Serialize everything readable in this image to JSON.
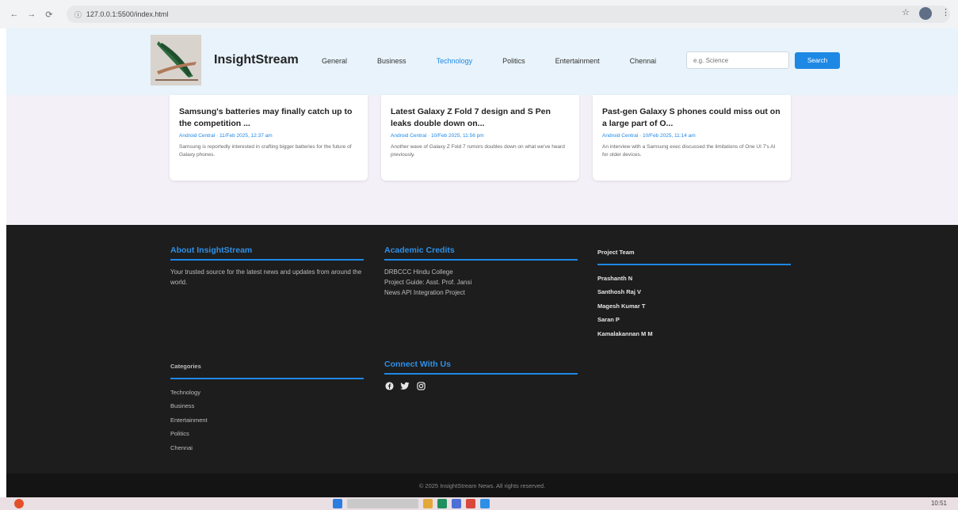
{
  "browser": {
    "url": "127.0.0.1:5500/index.html"
  },
  "header": {
    "brand": "InsightStream",
    "nav": [
      "General",
      "Business",
      "Technology",
      "Politics",
      "Entertainment",
      "Chennai"
    ],
    "active_nav": "Technology",
    "search_placeholder": "e.g. Science",
    "search_button": "Search"
  },
  "articles": [
    {
      "title": "Samsung's batteries may finally catch up to the competition ...",
      "meta": "Android Central · 11/Feb 2025, 12:37 am",
      "desc": "Samsung is reportedly interested in crafting bigger batteries for the future of Galaxy phones."
    },
    {
      "title": "Latest Galaxy Z Fold 7 design and S Pen leaks double down on...",
      "meta": "Android Central · 10/Feb 2025, 11:56 pm",
      "desc": "Another wave of Galaxy Z Fold 7 rumors doubles down on what we've heard previously."
    },
    {
      "title": "Past-gen Galaxy S phones could miss out on a large part of O...",
      "meta": "Android Central · 10/Feb 2025, 11:14 am",
      "desc": "An interview with a Samsung exec discussed the limitations of One UI 7's AI for older devices."
    }
  ],
  "footer": {
    "about": {
      "heading": "About InsightStream",
      "text": "Your trusted source for the latest news and updates from around the world."
    },
    "credits": {
      "heading": "Academic Credits",
      "lines": [
        "DRBCCC Hindu College",
        "Project Guide: Asst. Prof. Jansi",
        "News API Integration Project"
      ]
    },
    "team": {
      "heading": "Project Team",
      "members": [
        "Prashanth N",
        "Santhosh Raj V",
        "Magesh Kumar T",
        "Saran P",
        "Kamalakannan M M"
      ]
    },
    "categories": {
      "heading": "Categories",
      "items": [
        "Technology",
        "Business",
        "Entertainment",
        "Politics",
        "Chennai"
      ]
    },
    "connect": {
      "heading": "Connect With Us",
      "icons": [
        "facebook-icon",
        "twitter-icon",
        "instagram-icon"
      ]
    },
    "copyright": "© 2025 InsightStream News. All rights reserved."
  },
  "taskbar": {
    "time": "10:51"
  }
}
